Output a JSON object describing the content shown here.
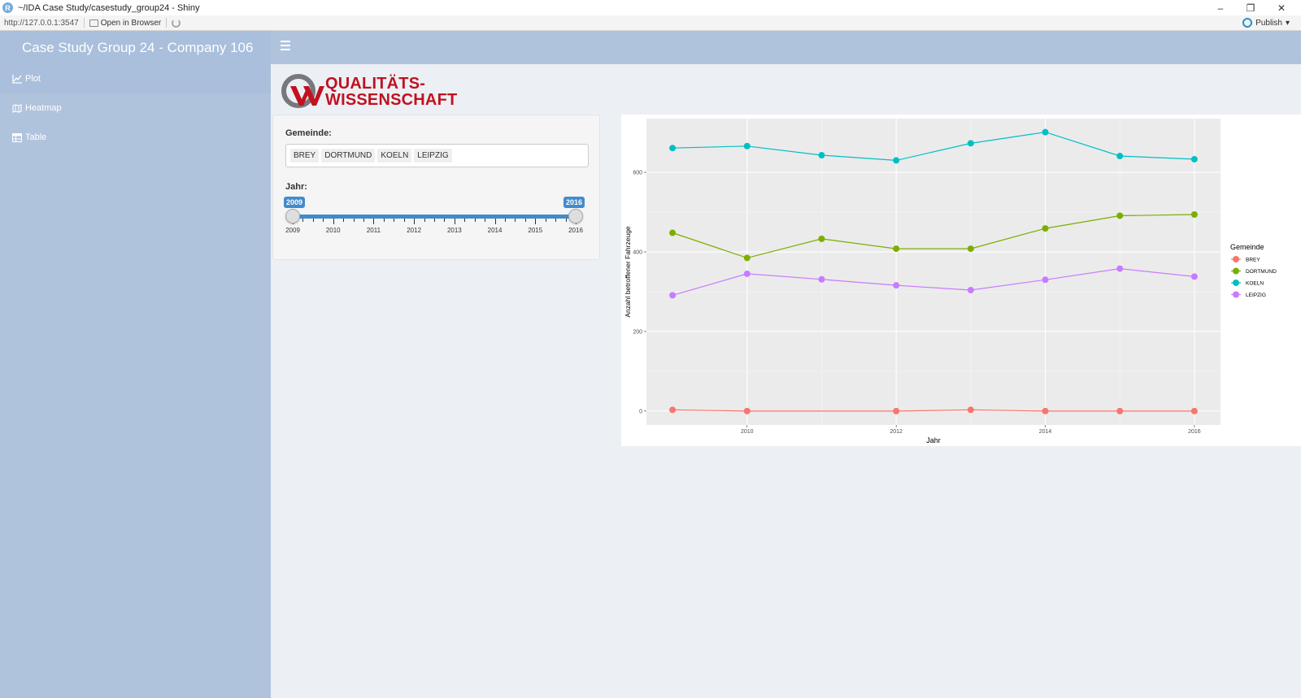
{
  "window": {
    "title": "~/IDA Case Study/casestudy_group24 - Shiny",
    "app_icon_letter": "R",
    "minimize": "–",
    "maximize": "❐",
    "close": "✕"
  },
  "toolbar": {
    "url": "http://127.0.0.1:3547",
    "open_in_browser": "Open in Browser",
    "publish": "Publish",
    "publish_caret": "▾"
  },
  "sidebar": {
    "brand": "Case Study Group 24 - Company 106",
    "items": [
      {
        "label": "Plot",
        "icon": "line-chart-icon"
      },
      {
        "label": "Heatmap",
        "icon": "map-icon"
      },
      {
        "label": "Table",
        "icon": "table-icon"
      }
    ]
  },
  "logo": {
    "line1": "QUALITÄTS-",
    "line2": "WISSENSCHAFT"
  },
  "controls": {
    "gemeinde_label": "Gemeinde:",
    "gemeinde_selected": [
      "BREY",
      "DORTMUND",
      "KOELN",
      "LEIPZIG"
    ],
    "jahr_label": "Jahr:",
    "slider_min": 2009,
    "slider_max": 2016,
    "slider_from": "2009",
    "slider_to": "2016",
    "slider_labels": [
      "2009",
      "2010",
      "2011",
      "2012",
      "2013",
      "2014",
      "2015",
      "2016"
    ]
  },
  "colors": {
    "BREY": "#f8766d",
    "DORTMUND": "#7cae00",
    "KOELN": "#00bfc4",
    "LEIPZIG": "#c77cff",
    "sidebar": "#b0c3dd",
    "slider": "#428bca",
    "logo_red": "#c0121f"
  },
  "chart_data": {
    "type": "line",
    "xlabel": "Jahr",
    "ylabel": "Anzahl betroffener Fahrzeuge",
    "x": [
      2009,
      2010,
      2011,
      2012,
      2013,
      2014,
      2015,
      2016
    ],
    "xticks": [
      2010,
      2012,
      2014,
      2016
    ],
    "yticks": [
      0,
      200,
      400,
      600
    ],
    "xlim": [
      2008.65,
      2016.35
    ],
    "ylim": [
      -35,
      735
    ],
    "grid": true,
    "legend_title": "Gemeinde",
    "legend_position": "right",
    "series": [
      {
        "name": "BREY",
        "values": [
          3,
          0,
          null,
          0,
          3,
          0,
          0,
          0
        ]
      },
      {
        "name": "DORTMUND",
        "values": [
          448,
          385,
          433,
          408,
          408,
          459,
          491,
          494
        ]
      },
      {
        "name": "KOELN",
        "values": [
          661,
          666,
          643,
          630,
          673,
          701,
          641,
          633
        ]
      },
      {
        "name": "LEIPZIG",
        "values": [
          291,
          345,
          331,
          316,
          304,
          330,
          358,
          338
        ]
      }
    ]
  }
}
